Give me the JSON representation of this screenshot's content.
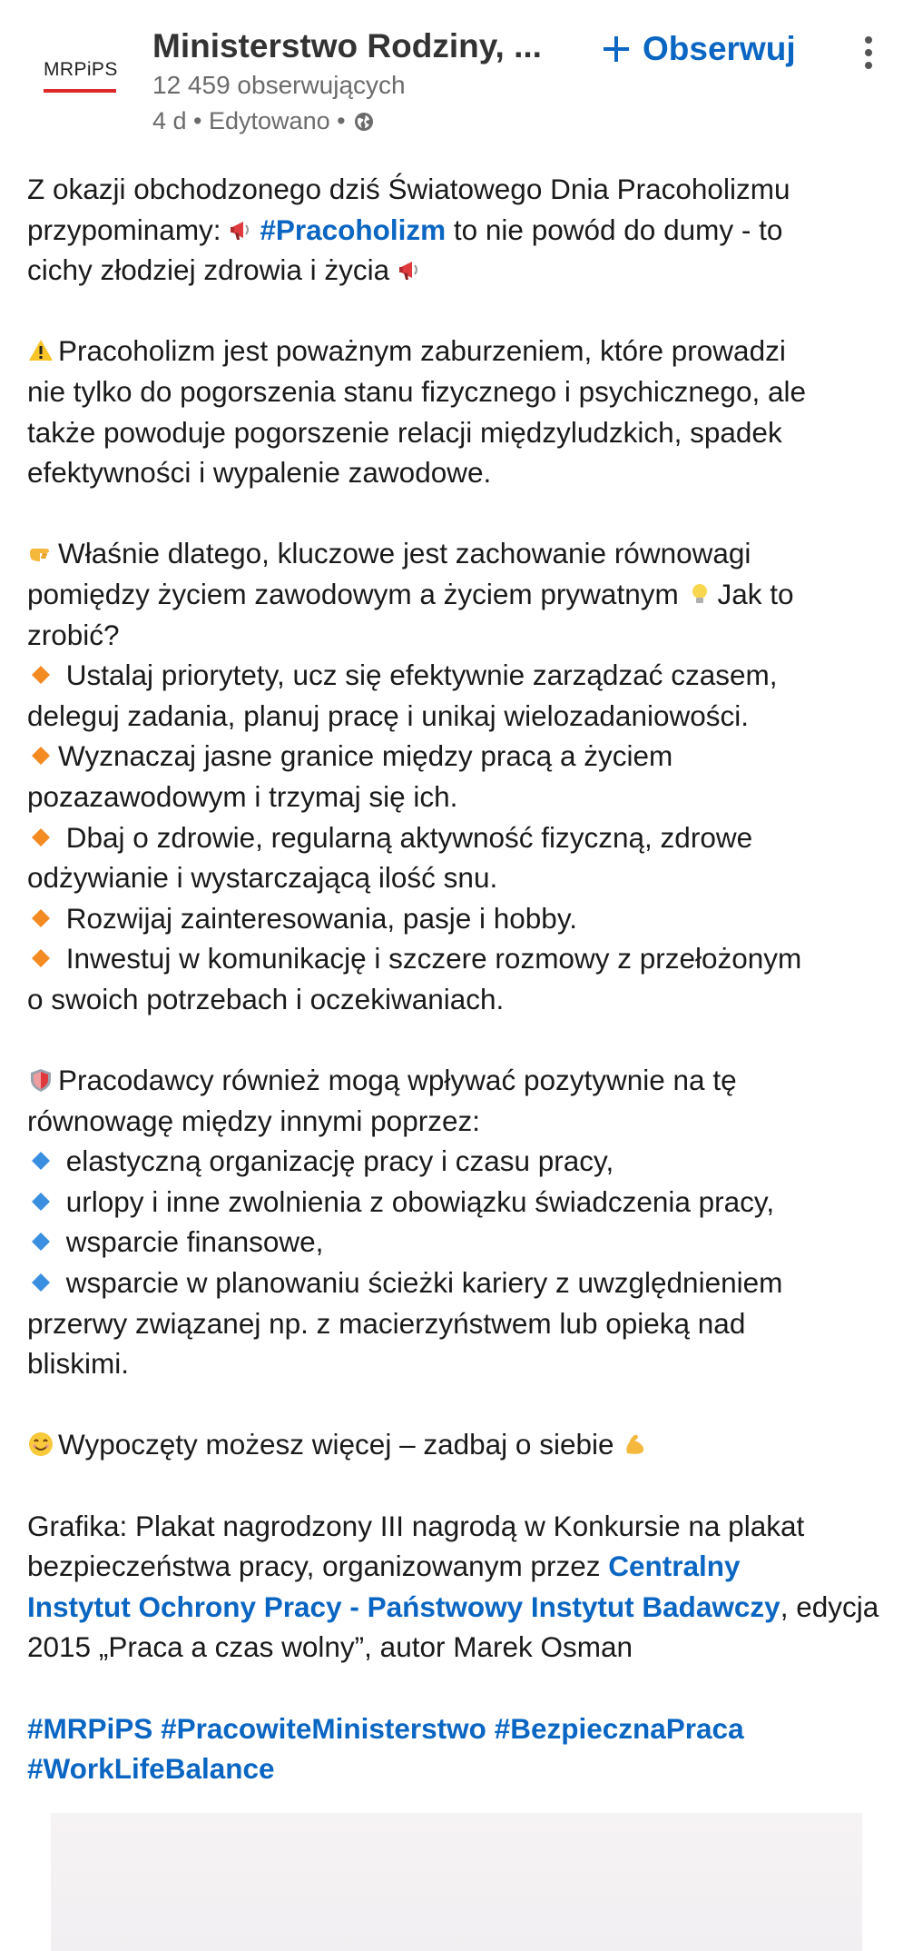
{
  "author": {
    "logo_text": "MRPiPS",
    "name": "Ministerstwo Rodziny, ...",
    "followers": "12 459 obserwujących",
    "time": "4 d",
    "edited": "Edytowano"
  },
  "actions": {
    "follow_label": "Obserwuj"
  },
  "post": {
    "l1": "Z okazji obchodzonego dziś Światowego Dnia Pracoholizmu",
    "l2a": "przypominamy: ",
    "l2_tag": "#Pracoholizm",
    "l2b": " to nie powód do dumy - to",
    "l3": "cichy złodziej zdrowia i życia",
    "p2": [
      "Pracoholizm jest poważnym zaburzeniem, które prowadzi",
      "nie tylko do pogorszenia stanu fizycznego i psychicznego, ale",
      "także powoduje pogorszenie relacji międzyludzkich, spadek",
      "efektywności i wypalenie zawodowe."
    ],
    "p3a": "Właśnie dlatego, kluczowe jest zachowanie równowagi",
    "p3b": "pomiędzy życiem zawodowym a życiem prywatnym",
    "p3c": "Jak to",
    "p3d": "zrobić?",
    "tips": [
      [
        "Ustalaj priorytety, ucz się efektywnie zarządzać czasem,",
        "deleguj zadania, planuj pracę i unikaj wielozadaniowości."
      ],
      [
        "Wyznaczaj jasne granice między pracą a życiem",
        "pozazawodowym i trzymaj się ich."
      ],
      [
        "Dbaj o zdrowie, regularną aktywność fizyczną, zdrowe",
        "odżywianie i wystarczającą ilość snu."
      ],
      [
        "Rozwijaj zainteresowania, pasje i hobby."
      ],
      [
        "Inwestuj w komunikację i szczere rozmowy z przełożonym",
        "o swoich potrzebach i oczekiwaniach."
      ]
    ],
    "p4a": "Pracodawcy również mogą wpływać pozytywnie na tę",
    "p4b": "równowagę między innymi poprzez:",
    "employer": [
      [
        "elastyczną organizację pracy i czasu pracy,"
      ],
      [
        "urlopy i inne zwolnienia z obowiązku świadczenia pracy,"
      ],
      [
        "wsparcie finansowe,"
      ],
      [
        "wsparcie w planowaniu ścieżki kariery z uwzględnieniem",
        "przerwy związanej np. z macierzyństwem lub opieką nad",
        "bliskimi."
      ]
    ],
    "p5": "Wypoczęty możesz więcej – zadbaj o siebie",
    "p6a": "Grafika: Plakat nagrodzony III nagrodą w Konkursie na plakat",
    "p6b": "bezpieczeństwa pracy, organizowanym przez ",
    "p6_link1": "Centralny",
    "p6_link2": "Instytut Ochrony Pracy - Państwowy Instytut Badawczy",
    "p6c": ", edycja",
    "p6d": "2015 „Praca a czas wolny”, autor Marek Osman",
    "hashtags_line1": [
      "#MRPiPS",
      "#PracowiteMinisterstwo",
      "#BezpiecznaPraca"
    ],
    "hashtags_line2": [
      "#WorkLifeBalance"
    ]
  },
  "colors": {
    "link": "#0a66c2",
    "text": "#1a1a1a",
    "meta": "#6b6b6b",
    "logo_bar": "#dc2a2a"
  }
}
